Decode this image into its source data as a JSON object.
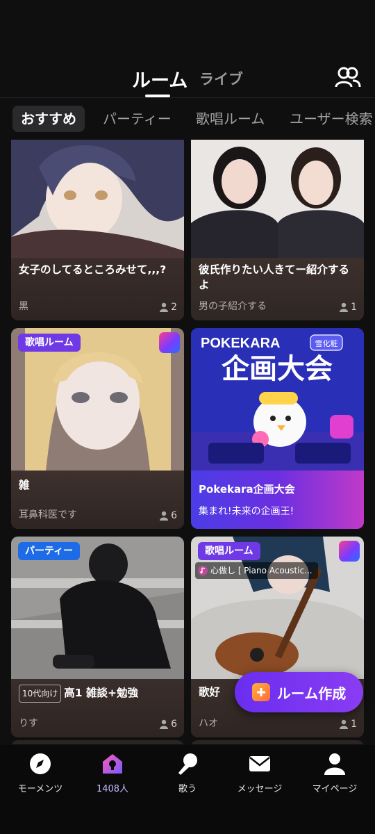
{
  "header": {
    "tab_rooms": "ルーム",
    "tab_live": "ライブ"
  },
  "categories": [
    "おすすめ",
    "パーティー",
    "歌唱ルーム",
    "ユーザー検索"
  ],
  "cards": [
    {
      "title": "女子のしてるところみせて,,,?",
      "host": "黒",
      "count": "2"
    },
    {
      "title": "彼氏作りたい人きてー紹介するよ",
      "host": "男の子紹介する",
      "count": "1"
    },
    {
      "badge": "歌唱ルーム",
      "title": "雑",
      "host": "耳鼻科医です",
      "count": "6"
    },
    {
      "banner_brand": "POKEKARA",
      "banner_tag": "雪化粧",
      "banner_headline": "企画大会",
      "title": "Pokekara企画大会",
      "subtitle": "集まれ!未来の企画王!"
    },
    {
      "badge": "パーティー",
      "tag": "10代向け",
      "title": "高1 雑談+勉強",
      "host": "りす",
      "count": "6"
    },
    {
      "badge": "歌唱ルーム",
      "song": "心做し [ Piano Acoustic...",
      "title": "歌好",
      "host": "ハオ",
      "count": "1"
    }
  ],
  "fab": {
    "label": "ルーム作成"
  },
  "bottom_nav": [
    {
      "label": "モーメンツ",
      "icon": "compass-icon"
    },
    {
      "label": "1408人",
      "icon": "house-icon"
    },
    {
      "label": "歌う",
      "icon": "mic-icon"
    },
    {
      "label": "メッセージ",
      "icon": "mail-icon"
    },
    {
      "label": "マイページ",
      "icon": "user-icon"
    }
  ]
}
